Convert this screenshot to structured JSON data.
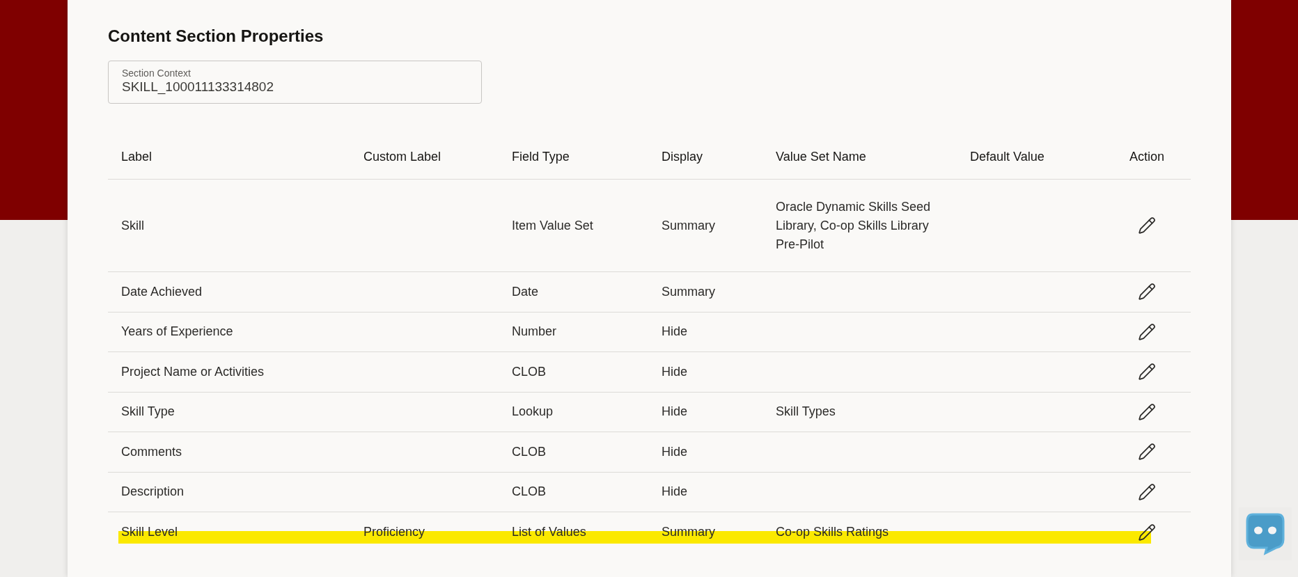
{
  "title": "Content Section Properties",
  "section_context": {
    "label": "Section Context",
    "value": "SKILL_100011133314802"
  },
  "table": {
    "columns": [
      "Label",
      "Custom Label",
      "Field Type",
      "Display",
      "Value Set Name",
      "Default Value",
      "Action"
    ],
    "rows": [
      {
        "label": "Skill",
        "custom_label": "",
        "field_type": "Item Value Set",
        "display": "Summary",
        "value_set_name": "Oracle Dynamic Skills Seed Library, Co-op Skills Library Pre-Pilot",
        "highlighted": false
      },
      {
        "label": "Date Achieved",
        "field_type": "Date",
        "display": "Summary",
        "highlighted": false
      },
      {
        "label": "Years of Experience",
        "field_type": "Number",
        "display": "Hide",
        "highlighted": false
      },
      {
        "label": "Project Name or Activities",
        "field_type": "CLOB",
        "display": "Hide",
        "highlighted": false
      },
      {
        "label": "Skill Type",
        "field_type": "Lookup",
        "display": "Hide",
        "value_set_name": "Skill Types",
        "highlighted": false
      },
      {
        "label": "Comments",
        "field_type": "CLOB",
        "display": "Hide",
        "highlighted": false
      },
      {
        "label": "Description",
        "field_type": "CLOB",
        "display": "Hide",
        "highlighted": false
      },
      {
        "label": "Skill Level",
        "custom_label": "Proficiency",
        "field_type": "List of Values",
        "display": "Summary",
        "value_set_name": "Co-op Skills Ratings",
        "highlighted": true
      }
    ]
  }
}
